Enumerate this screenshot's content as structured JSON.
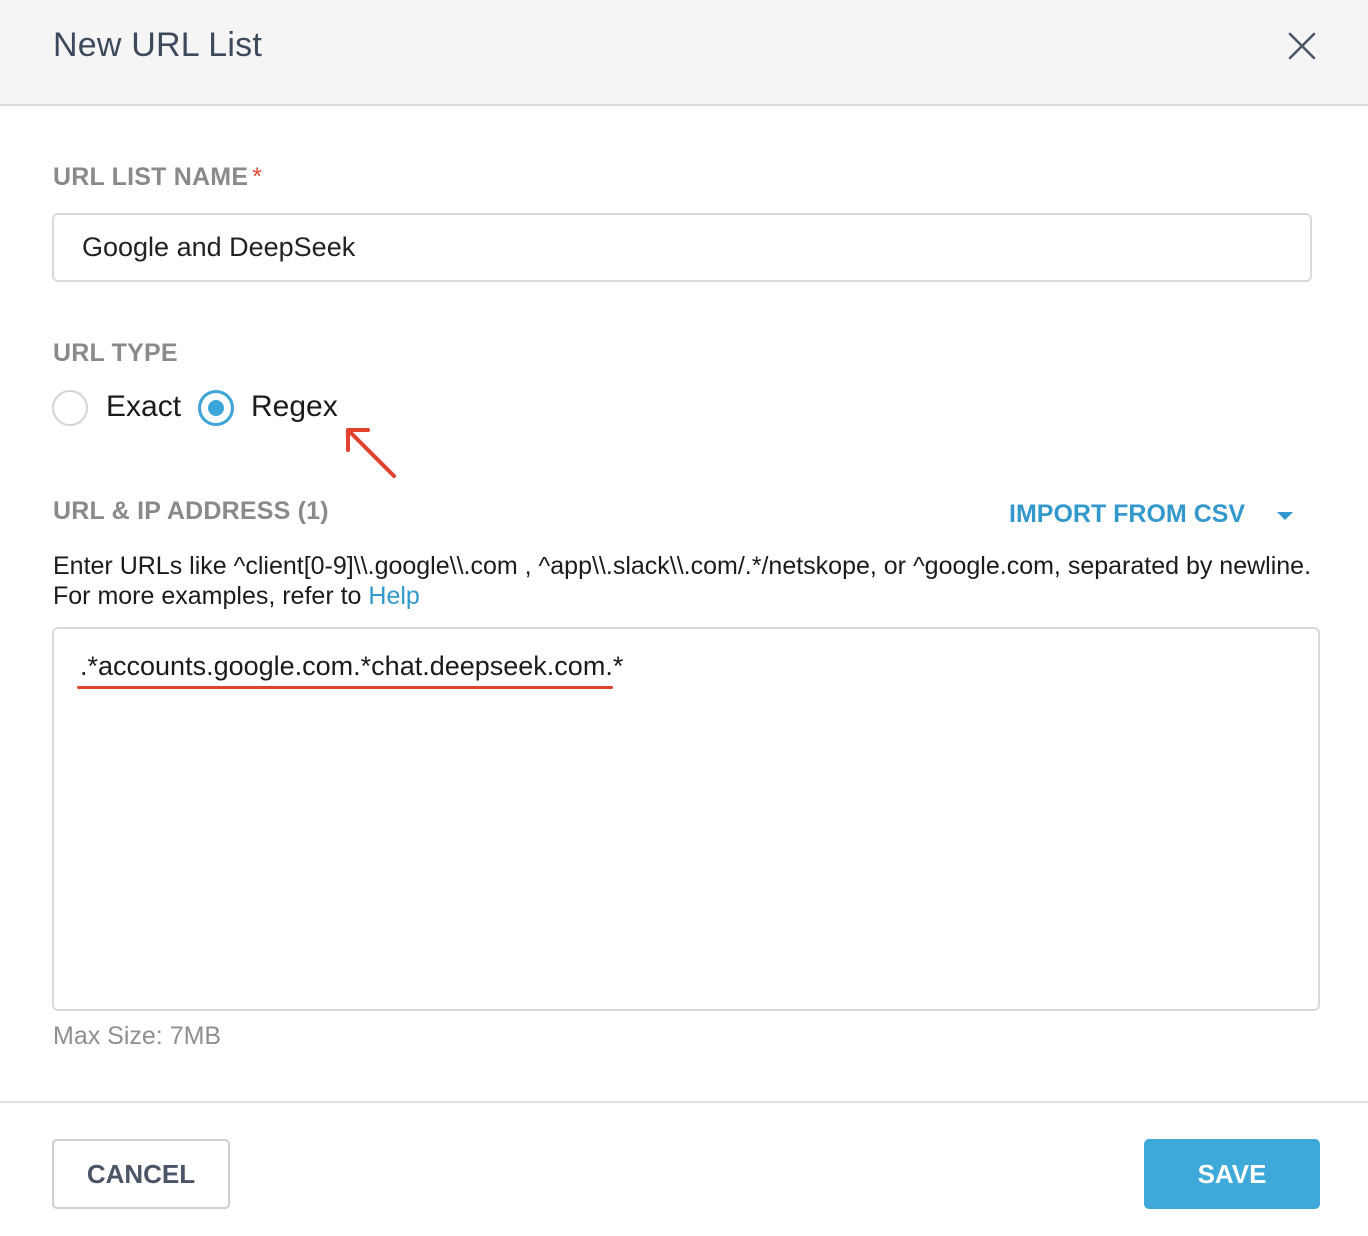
{
  "dialog": {
    "title": "New URL List",
    "close_icon": "close-icon"
  },
  "name_field": {
    "label": "URL LIST NAME",
    "required_marker": "*",
    "value": "Google and DeepSeek"
  },
  "url_type": {
    "label": "URL TYPE",
    "options": [
      {
        "label": "Exact",
        "checked": false
      },
      {
        "label": "Regex",
        "checked": true
      }
    ]
  },
  "urls": {
    "label": "URL & IP ADDRESS (1)",
    "import_label": "IMPORT FROM CSV",
    "help_text": "Enter URLs like ^client[0-9]\\\\.google\\\\.com , ^app\\\\.slack\\\\.com/.*/netskope, or ^google.com, separated by newline. For more examples, refer to ",
    "help_link": "Help",
    "value": ".*accounts.google.com.*chat.deepseek.com.*",
    "max_size": "Max Size: 7MB"
  },
  "footer": {
    "cancel_label": "CANCEL",
    "save_label": "SAVE"
  },
  "colors": {
    "accent": "#3ca9d9",
    "annotation": "#e2412e",
    "required": "#e34a3b"
  }
}
